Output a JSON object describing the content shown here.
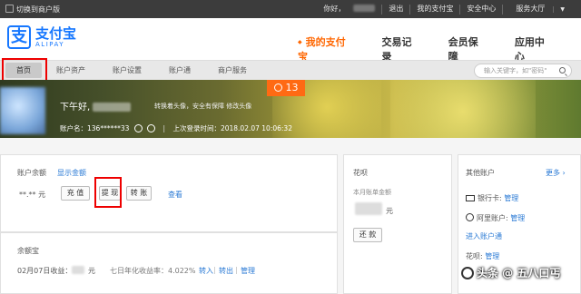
{
  "topbar": {
    "switch_label": "切换到商户版",
    "greeting": "你好，",
    "logout": "退出",
    "my_alipay": "我的支付宝",
    "security": "安全中心",
    "service_hall": "服务大厅"
  },
  "logo": {
    "cn": "支付宝",
    "en": "ALIPAY",
    "mark": "支"
  },
  "mainnav": {
    "items": [
      {
        "label": "我的支付宝",
        "active": true
      },
      {
        "label": "交易记录",
        "active": false
      },
      {
        "label": "会员保障",
        "active": false
      },
      {
        "label": "应用中心",
        "active": false
      }
    ]
  },
  "subnav": {
    "tabs": [
      "首页",
      "账户资产",
      "账户设置",
      "账户通",
      "商户服务"
    ],
    "search_placeholder": "输入关键字，如\"密码\""
  },
  "banner": {
    "hello": "下午好,",
    "links": "转换着头像，安全有保障 修改头像",
    "account_label": "账户名：136******33",
    "last_login": "上次登录时间：2018.02.07 10:06:32",
    "badge_count": "13"
  },
  "balance": {
    "title": "账户余额",
    "show_link": "显示金额",
    "amount": "**.** 元",
    "recharge": "充 值",
    "withdraw": "提 现",
    "transfer": "转 账",
    "view": "查看"
  },
  "yuebao": {
    "title": "余额宝",
    "date_label": "02月07日收益：",
    "unit": "元",
    "rate": "七日年化收益率：4.022%",
    "in": "转入",
    "out": "转出",
    "manage": "管理"
  },
  "huabei": {
    "title": "花呗",
    "bill_label": "本月账单金额",
    "unit": "元",
    "repay": "还 款"
  },
  "other": {
    "title": "其他账户",
    "more": "更多",
    "bank_card": "银行卡:",
    "bank_manage": "管理",
    "ali_point": "阿里账户:",
    "ali_manage": "管理",
    "enter": "进入账户通",
    "huabei": "花呗:",
    "huabei_manage": "管理"
  },
  "watermark": "头条 @ 五八口丐"
}
